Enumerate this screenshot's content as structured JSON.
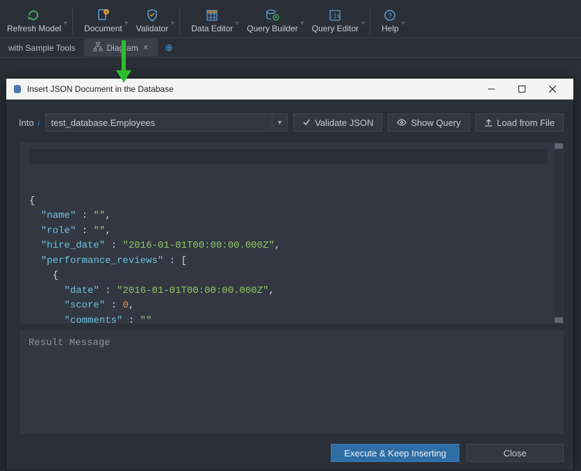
{
  "toolbar": {
    "items": [
      {
        "label": "Refresh Model"
      },
      {
        "label": "Document"
      },
      {
        "label": "Validator"
      },
      {
        "label": "Data Editor"
      },
      {
        "label": "Query Builder"
      },
      {
        "label": "Query Editor"
      },
      {
        "label": "Help"
      }
    ]
  },
  "tabs": {
    "sample": "with Sample Tools",
    "diagram": "Diagram"
  },
  "dialog": {
    "title": "Insert JSON Document in the Database",
    "into_label": "Into",
    "into_value": "test_database.Employees",
    "buttons": {
      "validate": "Validate JSON",
      "show_query": "Show Query",
      "load_file": "Load from File",
      "execute": "Execute & Keep Inserting",
      "close": "Close"
    },
    "result_placeholder": "Result Message"
  },
  "json_doc": {
    "keys": {
      "name": "name",
      "role": "role",
      "hire_date": "hire_date",
      "performance_reviews": "performance_reviews",
      "date": "date",
      "score": "score",
      "comments": "comments"
    },
    "values": {
      "name": "",
      "role": "",
      "hire_date": "2016-01-01T00:00:00.000Z",
      "date": "2016-01-01T00:00:00.000Z",
      "score": "0",
      "comments": ""
    }
  }
}
